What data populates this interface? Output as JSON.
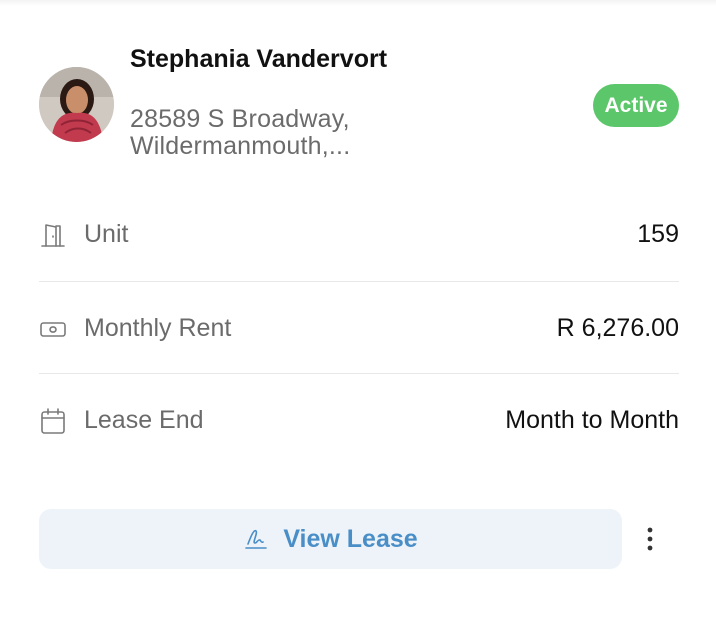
{
  "tenant": {
    "name": "Stephania Vandervort",
    "address": "28589 S Broadway, Wildermanmouth,...",
    "status": "Active"
  },
  "details": [
    {
      "icon": "door-icon",
      "label": "Unit",
      "value": "159"
    },
    {
      "icon": "money-icon",
      "label": "Monthly Rent",
      "value": "R 6,276.00"
    },
    {
      "icon": "calendar-icon",
      "label": "Lease End",
      "value": "Month to Month"
    }
  ],
  "actions": {
    "view_lease_label": "View Lease",
    "view_lease_icon": "signature-icon",
    "more_icon": "more-vertical-icon"
  },
  "colors": {
    "status_green": "#5cc66a",
    "button_bg": "#edf3f8",
    "button_text": "#4a8ec8"
  }
}
